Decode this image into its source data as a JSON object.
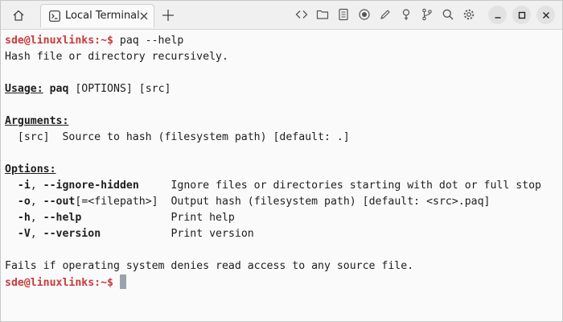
{
  "tab": {
    "label": "Local Terminal"
  },
  "icons": {
    "home": "home-icon",
    "terminal": "terminal-icon",
    "close": "close-icon",
    "add": "plus-icon",
    "toolbar": [
      "code-icon",
      "folder-icon",
      "document-icon",
      "record-icon",
      "pen-icon",
      "pin-icon",
      "branch-icon",
      "search-icon",
      "gear-icon"
    ],
    "window": [
      "minimize-icon",
      "maximize-icon",
      "close-window-icon"
    ]
  },
  "colors": {
    "prompt": "#c93a3a",
    "text": "#1e1e1e",
    "background": "#fafafa",
    "cursor": "#9aa3ad"
  },
  "terminal": {
    "prompt": "sde@linuxlinks:~$",
    "command": " paq --help",
    "description": "Hash file or directory recursively.",
    "usage_label": "Usage:",
    "usage_cmd": "paq",
    "usage_args": " [OPTIONS] [src]",
    "arguments_label": "Arguments:",
    "argument": "  [src]  Source to hash (filesystem path) [default: .]",
    "options_label": "Options:",
    "options": [
      {
        "short": "-i",
        "long": "--ignore-hidden",
        "extra": "",
        "pad": "     ",
        "desc": "Ignore files or directories starting with dot or full stop"
      },
      {
        "short": "-o",
        "long": "--out",
        "extra": "[=<filepath>]",
        "pad": "  ",
        "desc": "Output hash (filesystem path) [default: <src>.paq]"
      },
      {
        "short": "-h",
        "long": "--help",
        "extra": "",
        "pad": "              ",
        "desc": "Print help"
      },
      {
        "short": "-V",
        "long": "--version",
        "extra": "",
        "pad": "           ",
        "desc": "Print version"
      }
    ],
    "footer": "Fails if operating system denies read access to any source file."
  }
}
